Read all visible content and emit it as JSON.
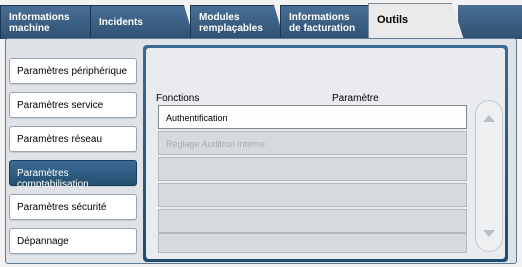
{
  "tabs": [
    {
      "label_line1": "Informations",
      "label_line2": "machine"
    },
    {
      "label_line1": "Incidents",
      "label_line2": ""
    },
    {
      "label_line1": "Modules",
      "label_line2": "remplaçables"
    },
    {
      "label_line1": "Informations",
      "label_line2": "de facturation"
    },
    {
      "label_line1": "Outils",
      "label_line2": ""
    }
  ],
  "sidebar": {
    "items": [
      {
        "label": "Paramètres périphérique"
      },
      {
        "label": "Paramètres service"
      },
      {
        "label": "Paramètres réseau"
      },
      {
        "label": "Paramètres comptabilisation"
      },
      {
        "label": "Paramètres sécurité"
      },
      {
        "label": "Dépannage"
      }
    ],
    "selected": "Paramètres comptabilisation"
  },
  "content": {
    "col_fonctions": "Fonctions",
    "col_parametre": "Paramètre",
    "rows": [
      {
        "label": "Authentification"
      },
      {
        "label": "Réglage Auditron interne"
      },
      {
        "label": ""
      },
      {
        "label": ""
      },
      {
        "label": ""
      },
      {
        "label": ""
      }
    ]
  },
  "colors": {
    "tab_blue": "#3a6186",
    "selected_blue": "#2e5a7f",
    "disabled_text": "#aaaaaa"
  },
  "icons": {
    "scroll_up": "triangle-up-icon",
    "scroll_down": "triangle-down-icon"
  }
}
